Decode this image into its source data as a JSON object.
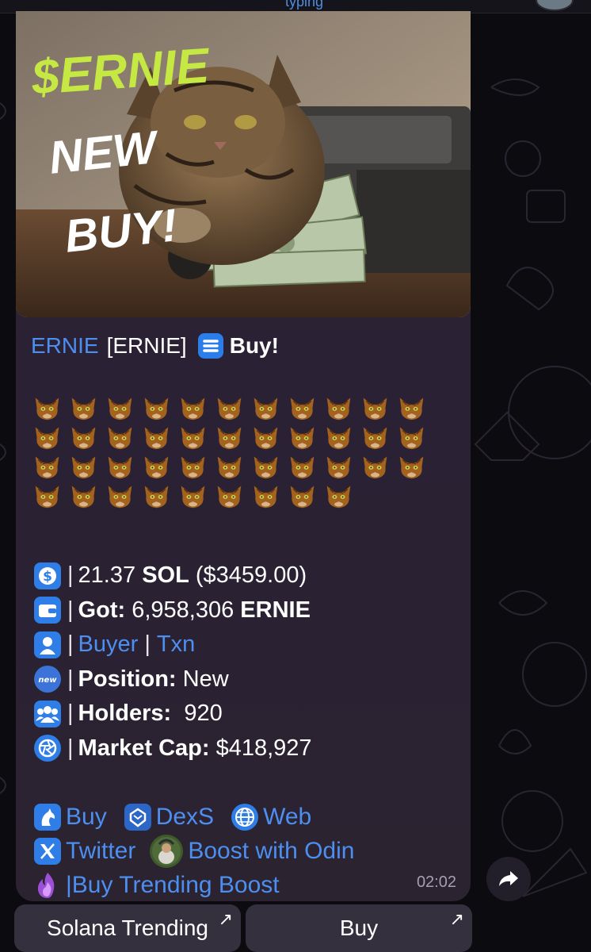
{
  "status_bar": {
    "typing_text": "typing"
  },
  "photo": {
    "caption_line1": "$ERNIE",
    "caption_line2": "NEW",
    "caption_line3": "BUY!"
  },
  "message": {
    "token_name": "ERNIE",
    "token_ticker": "[ERNIE]",
    "buy_label": "Buy!",
    "emoji_rows": [
      11,
      11,
      11,
      9
    ],
    "info": [
      {
        "icon": "dollar-icon",
        "sep": "|",
        "value": "21.37",
        "bold": "SOL",
        "rest": "($3459.00)"
      },
      {
        "icon": "wallet-icon",
        "sep": "|",
        "label": "Got:",
        "value": "6,958,306",
        "bold": "ERNIE"
      },
      {
        "icon": "person-icon",
        "sep": "|",
        "link1": "Buyer",
        "mid": "|",
        "link2": "Txn"
      },
      {
        "icon": "new-badge-icon",
        "sep": "|",
        "label": "Position:",
        "value": "New"
      },
      {
        "icon": "holders-icon",
        "sep": "|",
        "label": "Holders:",
        "value": "920"
      },
      {
        "icon": "aperture-icon",
        "sep": "|",
        "label": "Market Cap:",
        "value": "$418,927"
      }
    ],
    "links": {
      "buy": "Buy",
      "dexs": "DexS",
      "web": "Web",
      "twitter": "Twitter",
      "boost_odin": "Boost with Odin",
      "pipe": "|",
      "trending_boost": "Buy Trending Boost"
    },
    "time": "02:02"
  },
  "keyboard": {
    "button1": "Solana Trending",
    "button2": "Buy"
  },
  "colors": {
    "link": "#4d8ff0",
    "bubble": "#2b2333",
    "caption_green": "#c6e843"
  }
}
